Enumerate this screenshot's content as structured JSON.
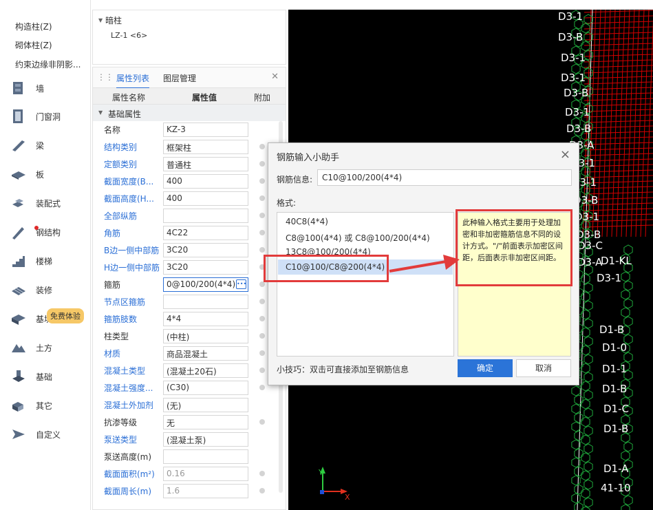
{
  "left_nav": {
    "top_items": [
      "构造柱(Z)",
      "砌体柱(Z)",
      "约束边缘非阴影..."
    ],
    "items": [
      {
        "label": "墙",
        "icon": "wall-icon"
      },
      {
        "label": "门窗洞",
        "icon": "door-window-icon"
      },
      {
        "label": "梁",
        "icon": "beam-icon"
      },
      {
        "label": "板",
        "icon": "slab-icon"
      },
      {
        "label": "装配式",
        "icon": "prefab-icon"
      },
      {
        "label": "钢结构",
        "icon": "steel-structure-icon"
      },
      {
        "label": "楼梯",
        "icon": "stairs-icon"
      },
      {
        "label": "装修",
        "icon": "decoration-icon"
      },
      {
        "label": "基坑",
        "icon": "pit-icon"
      },
      {
        "label": "土方",
        "icon": "earthwork-icon"
      },
      {
        "label": "基础",
        "icon": "foundation-icon"
      },
      {
        "label": "其它",
        "icon": "other-icon"
      },
      {
        "label": "自定义",
        "icon": "custom-icon"
      }
    ],
    "trial_badge": "免费体验"
  },
  "tree": {
    "group": "暗柱",
    "item": "LZ-1 <6>"
  },
  "properties": {
    "tabs": [
      "属性列表",
      "图层管理"
    ],
    "columns": {
      "name": "属性名称",
      "value": "属性值",
      "extra": "附加"
    },
    "group": "基础属性",
    "rows": [
      {
        "name": "名称",
        "value": "KZ-3",
        "blue": false,
        "check": false
      },
      {
        "name": "结构类别",
        "value": "框架柱",
        "blue": true,
        "check": true
      },
      {
        "name": "定额类别",
        "value": "普通柱",
        "blue": true,
        "check": true
      },
      {
        "name": "截面宽度(B...",
        "value": "400",
        "blue": true,
        "check": true
      },
      {
        "name": "截面高度(H...",
        "value": "400",
        "blue": true,
        "check": true
      },
      {
        "name": "全部纵筋",
        "value": "",
        "blue": true,
        "check": true
      },
      {
        "name": "角筋",
        "value": "4C22",
        "blue": true,
        "check": true
      },
      {
        "name": "B边一侧中部筋",
        "value": "3C20",
        "blue": true,
        "check": true
      },
      {
        "name": "H边一侧中部筋",
        "value": "3C20",
        "blue": true,
        "check": true
      },
      {
        "name": "箍筋",
        "value": "0@100/200(4*4)",
        "blue": false,
        "check": true,
        "active": true
      },
      {
        "name": "节点区箍筋",
        "value": "",
        "blue": true,
        "check": true
      },
      {
        "name": "箍筋肢数",
        "value": "4*4",
        "blue": true,
        "check": true
      },
      {
        "name": "柱类型",
        "value": "(中柱)",
        "blue": false,
        "check": true
      },
      {
        "name": "材质",
        "value": "商品混凝土",
        "blue": true,
        "check": true
      },
      {
        "name": "混凝土类型",
        "value": "(混凝土20石)",
        "blue": true,
        "check": true
      },
      {
        "name": "混凝土强度...",
        "value": "(C30)",
        "blue": true,
        "check": true
      },
      {
        "name": "混凝土外加剂",
        "value": "(无)",
        "blue": true,
        "check": false
      },
      {
        "name": "抗渗等级",
        "value": "无",
        "blue": false,
        "check": true
      },
      {
        "name": "泵送类型",
        "value": "(混凝土泵)",
        "blue": true,
        "check": false
      },
      {
        "name": "泵送高度(m)",
        "value": "",
        "blue": false,
        "check": false
      },
      {
        "name": "截面面积(m²)",
        "value": "0.16",
        "blue": true,
        "check": true,
        "grey": true
      },
      {
        "name": "截面周长(m)",
        "value": "1.6",
        "blue": true,
        "check": true,
        "grey": true
      }
    ]
  },
  "dialog": {
    "title": "钢筋输入小助手",
    "field_label": "钢筋信息:",
    "field_value": "C10@100/200(4*4)",
    "format_label": "格式:",
    "formats": [
      "40C8(4*4)",
      "C8@100(4*4) 或 C8@100/200(4*4)",
      "13C8@100/200(4*4)",
      "C10@100/C8@200(4*4)"
    ],
    "selected_format": 3,
    "description": "此种输入格式主要用于处理加密和非加密箍筋信息不同的设计方式。\"/\"前面表示加密区间距，后面表示非加密区间距。",
    "tip": "小技巧：双击可直接添加至钢筋信息",
    "ok_label": "确定",
    "cancel_label": "取消"
  },
  "cad": {
    "labels": [
      "D3-1",
      "D3-B",
      "D3-1",
      "D3-1",
      "D3-B",
      "D3-1",
      "D3-B",
      "D3-A",
      "D3-1",
      "D3-1",
      "D3-B",
      "D3-1",
      "D3-B",
      "D3-C",
      "D1-KL",
      "D3-A",
      "D3-1",
      "D1-B",
      "D1-0",
      "D1-1",
      "D1-B",
      "D1-C",
      "D1-B",
      "D1-A",
      "41-10"
    ],
    "axis_y": "Y",
    "axis_x": "X",
    "colors": {
      "background": "#000000",
      "text": "#ffffff",
      "grid": "#d40000",
      "hex": "#1fa83c",
      "annotation": "#e23b3b"
    }
  }
}
